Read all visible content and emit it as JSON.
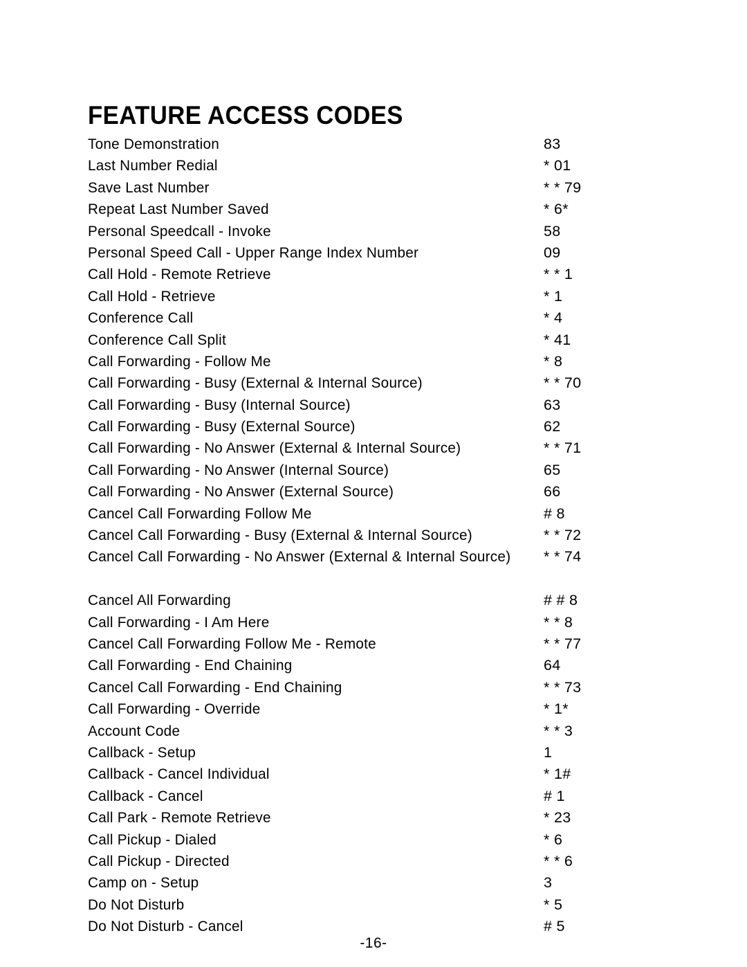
{
  "document": {
    "title": "FEATURE ACCESS CODES",
    "page_number": "-16-"
  },
  "table": {
    "rows": [
      {
        "label": "Tone Demonstration",
        "code": "83"
      },
      {
        "label": "Last Number Redial",
        "code": "* 01"
      },
      {
        "label": "Save Last Number",
        "code": "* * 79"
      },
      {
        "label": "Repeat Last Number Saved",
        "code": "* 6*"
      },
      {
        "label": "Personal Speedcall - Invoke",
        "code": "58"
      },
      {
        "label": "Personal Speed Call - Upper Range Index Number",
        "code": "09"
      },
      {
        "label": "Call Hold - Remote Retrieve",
        "code": "* * 1"
      },
      {
        "label": "Call Hold - Retrieve",
        "code": "* 1"
      },
      {
        "label": "Conference Call",
        "code": "* 4"
      },
      {
        "label": "Conference Call Split",
        "code": "* 41"
      },
      {
        "label": "Call Forwarding - Follow Me",
        "code": "* 8"
      },
      {
        "label": "Call Forwarding - Busy (External & Internal Source)",
        "code": "* * 70"
      },
      {
        "label": "Call Forwarding - Busy (Internal Source)",
        "code": "63"
      },
      {
        "label": "Call Forwarding - Busy (External Source)",
        "code": "62"
      },
      {
        "label": "Call Forwarding - No Answer (External & Internal Source)",
        "code": "* * 71"
      },
      {
        "label": "Call Forwarding - No Answer (Internal Source)",
        "code": "65"
      },
      {
        "label": "Call Forwarding - No Answer (External Source)",
        "code": "66"
      },
      {
        "label": "Cancel Call Forwarding Follow Me",
        "code": "# 8"
      },
      {
        "label": "Cancel Call Forwarding - Busy (External & Internal Source)",
        "code": "* * 72"
      },
      {
        "label": "Cancel Call Forwarding - No Answer (External & Internal Source)",
        "code": "* * 74",
        "wrap": true
      },
      {
        "label": "Cancel All Forwarding",
        "code": "# # 8"
      },
      {
        "label": "Call Forwarding - I Am Here",
        "code": "* * 8"
      },
      {
        "label": "Cancel Call Forwarding Follow Me - Remote",
        "code": "* * 77"
      },
      {
        "label": "Call Forwarding - End Chaining",
        "code": "64"
      },
      {
        "label": "Cancel Call Forwarding - End Chaining",
        "code": "* * 73"
      },
      {
        "label": "Call Forwarding - Override",
        "code": "* 1*"
      },
      {
        "label": "Account Code",
        "code": "* * 3"
      },
      {
        "label": "Callback - Setup",
        "code": "1"
      },
      {
        "label": "Callback - Cancel Individual",
        "code": "* 1#"
      },
      {
        "label": "Callback - Cancel",
        "code": "# 1"
      },
      {
        "label": "Call Park - Remote Retrieve",
        "code": "* 23"
      },
      {
        "label": "Call Pickup - Dialed",
        "code": "* 6"
      },
      {
        "label": "Call Pickup - Directed",
        "code": "* * 6"
      },
      {
        "label": "Camp on - Setup",
        "code": "3"
      },
      {
        "label": "Do Not Disturb",
        "code": "* 5"
      },
      {
        "label": "Do Not Disturb - Cancel",
        "code": "# 5"
      }
    ]
  }
}
